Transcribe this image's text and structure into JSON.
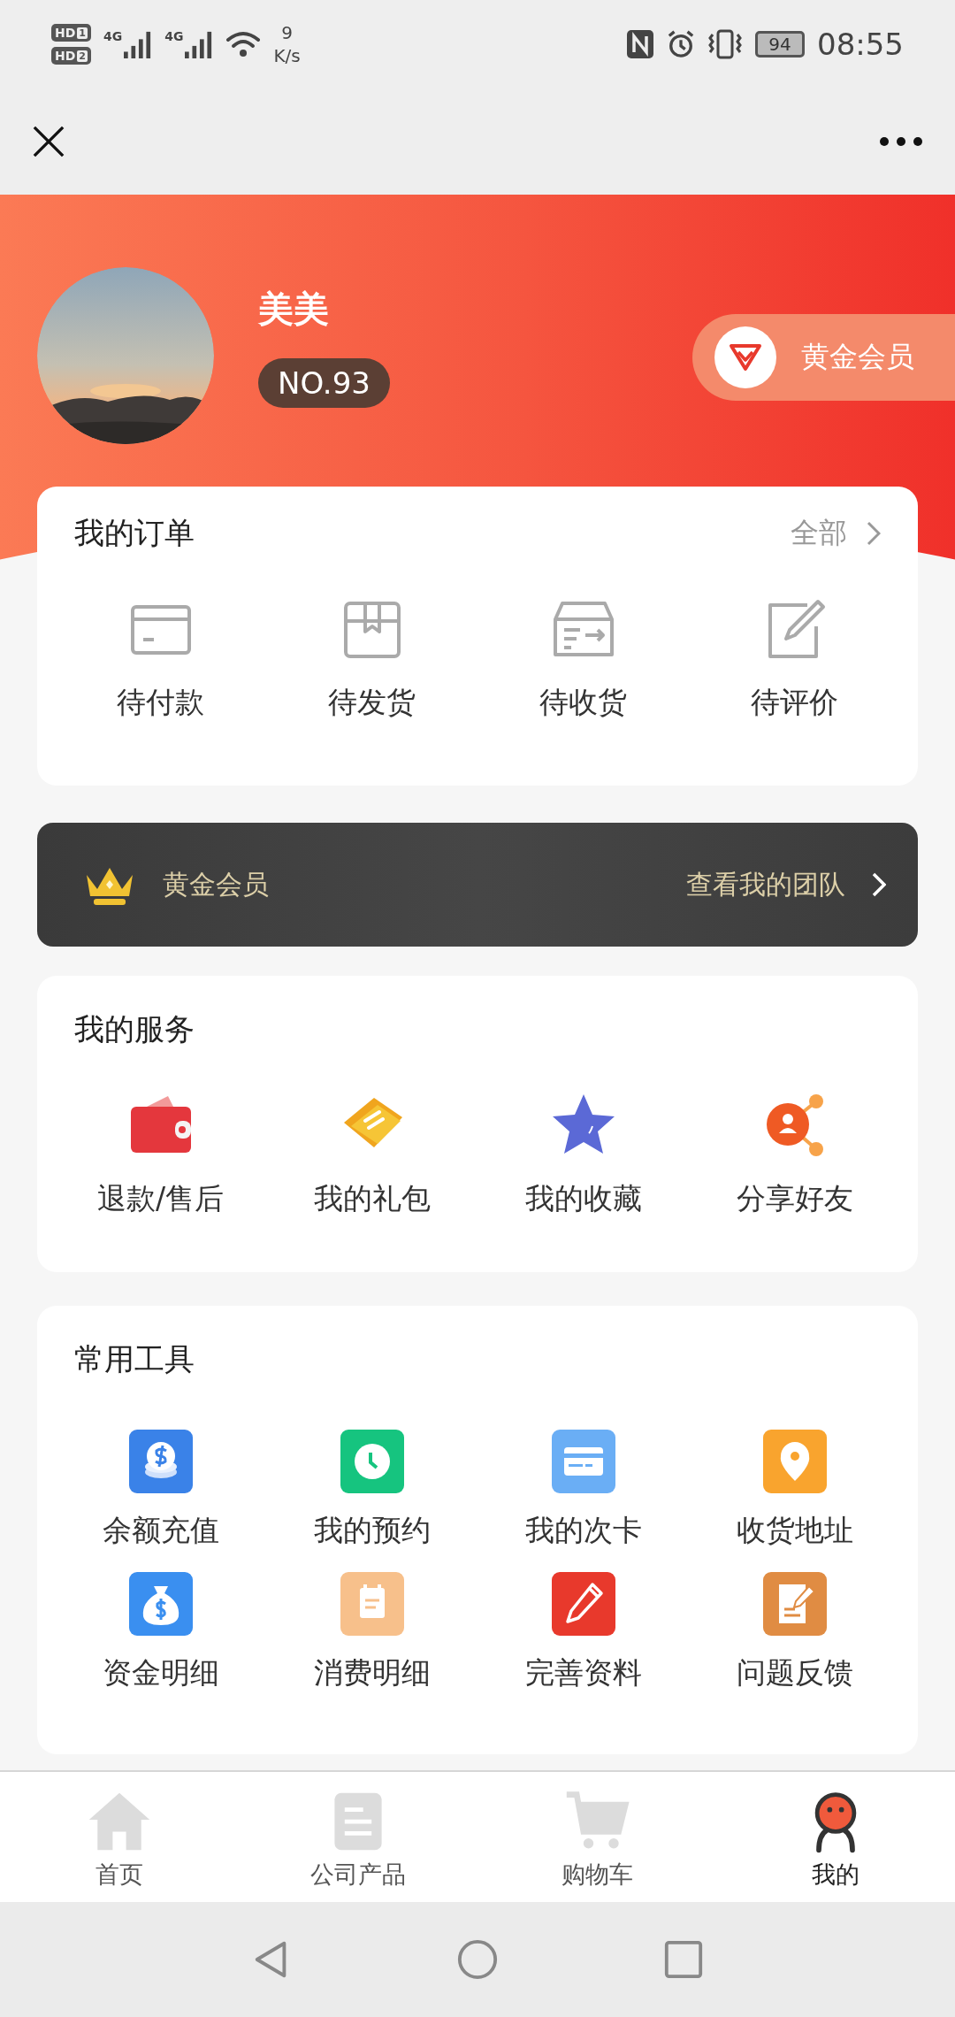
{
  "status_bar": {
    "sims": [
      {
        "hd": "HD",
        "slot": "1",
        "network": "4G"
      },
      {
        "hd": "HD",
        "slot": "2",
        "network": "4G"
      }
    ],
    "speed_value": "9",
    "speed_unit": "K/s",
    "battery": "94",
    "time": "08:55"
  },
  "profile": {
    "name": "美美",
    "number": "NO.93",
    "membership": "黄金会员"
  },
  "orders": {
    "title": "我的订单",
    "all_link": "全部",
    "items": [
      "待付款",
      "待发货",
      "待收货",
      "待评价"
    ]
  },
  "member_bar": {
    "level": "黄金会员",
    "link": "查看我的团队"
  },
  "services": {
    "title": "我的服务",
    "items": [
      "退款/售后",
      "我的礼包",
      "我的收藏",
      "分享好友"
    ]
  },
  "tools": {
    "title": "常用工具",
    "items": [
      {
        "label": "余额充值",
        "color": "#3a82e8"
      },
      {
        "label": "我的预约",
        "color": "#16c47f"
      },
      {
        "label": "我的次卡",
        "color": "#6aaef5"
      },
      {
        "label": "收货地址",
        "color": "#f9a42e"
      },
      {
        "label": "资金明细",
        "color": "#3a8ff0"
      },
      {
        "label": "消费明细",
        "color": "#f7c08b"
      },
      {
        "label": "完善资料",
        "color": "#e8392c"
      },
      {
        "label": "问题反馈",
        "color": "#e08c43"
      }
    ]
  },
  "tab_bar": [
    {
      "label": "首页",
      "selected": false
    },
    {
      "label": "公司产品",
      "selected": false
    },
    {
      "label": "购物车",
      "selected": false
    },
    {
      "label": "我的",
      "selected": true
    }
  ]
}
